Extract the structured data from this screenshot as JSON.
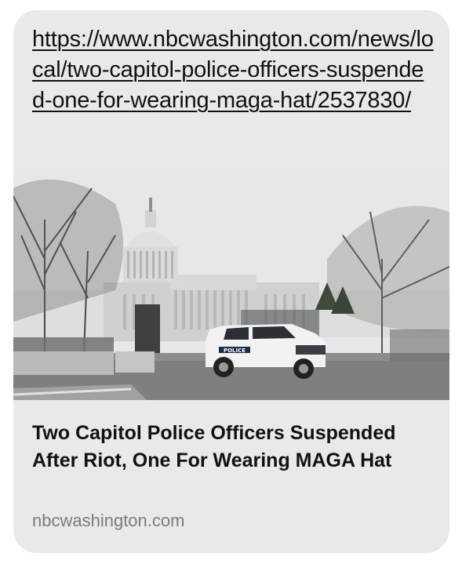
{
  "link_preview": {
    "url": "https://www.nbcwashington.com/news/local/two-capitol-police-officers-suspended-one-for-wearing-maga-hat/2537830/",
    "title": "Two Capitol Police Officers Suspended After Riot, One For Wearing MAGA Hat",
    "domain": "nbcwashington.com",
    "image_subject": "us-capitol-with-police-vehicle-and-security-fence",
    "vehicle_marking": "POLICE"
  },
  "colors": {
    "bubble_background": "#e9e9eb",
    "text": "#111111",
    "domain_text": "#7c7c80"
  }
}
